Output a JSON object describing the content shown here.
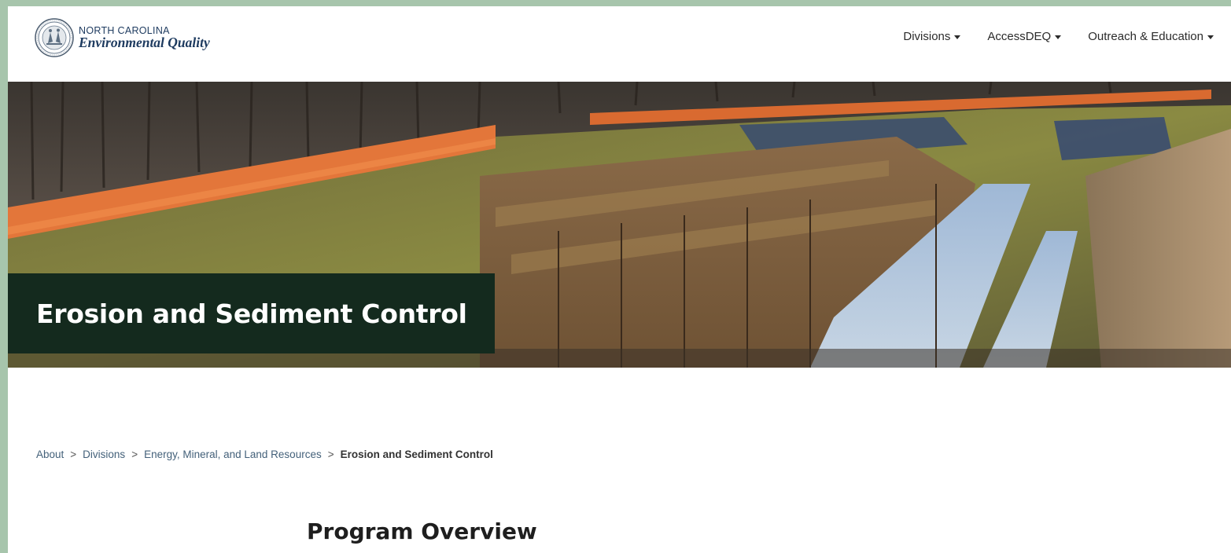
{
  "header": {
    "logo": {
      "line1": "NORTH CAROLINA",
      "line2": "Environmental Quality",
      "seal_icon": "nc-state-seal-icon"
    },
    "nav": [
      {
        "label": "Divisions",
        "icon": "caret-down-icon"
      },
      {
        "label": "AccessDEQ",
        "icon": "caret-down-icon"
      },
      {
        "label": "Outreach & Education",
        "icon": "caret-down-icon"
      }
    ]
  },
  "hero": {
    "title": "Erosion and Sediment Control"
  },
  "breadcrumb": {
    "items": [
      "About",
      "Divisions",
      "Energy, Mineral, and Land Resources"
    ],
    "separator": ">",
    "current": "Erosion and Sediment Control"
  },
  "main": {
    "section_heading": "Program Overview"
  },
  "colors": {
    "frame_background": "#a7c5ac",
    "hero_title_box": "#142a1e",
    "brand_navy": "#1d3a5f",
    "breadcrumb_link": "#44617a"
  }
}
